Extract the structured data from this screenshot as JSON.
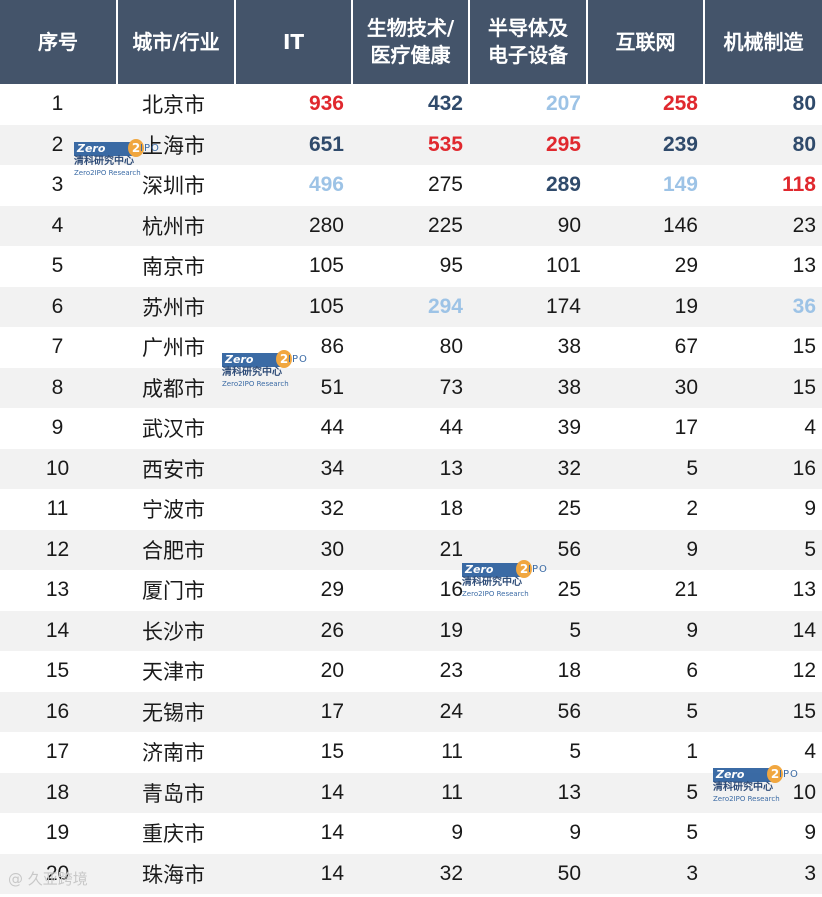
{
  "table": {
    "headers": [
      "序号",
      "城市/行业",
      "IT",
      "生物技术/\n医疗健康",
      "半导体及\n电子设备",
      "互联网",
      "机械制造"
    ],
    "rows": [
      {
        "rank": "1",
        "city": "北京市",
        "values": [
          "936",
          "432",
          "207",
          "258",
          "80"
        ]
      },
      {
        "rank": "2",
        "city": "上海市",
        "values": [
          "651",
          "535",
          "295",
          "239",
          "80"
        ]
      },
      {
        "rank": "3",
        "city": "深圳市",
        "values": [
          "496",
          "275",
          "289",
          "149",
          "118"
        ]
      },
      {
        "rank": "4",
        "city": "杭州市",
        "values": [
          "280",
          "225",
          "90",
          "146",
          "23"
        ]
      },
      {
        "rank": "5",
        "city": "南京市",
        "values": [
          "105",
          "95",
          "101",
          "29",
          "13"
        ]
      },
      {
        "rank": "6",
        "city": "苏州市",
        "values": [
          "105",
          "294",
          "174",
          "19",
          "36"
        ]
      },
      {
        "rank": "7",
        "city": "广州市",
        "values": [
          "86",
          "80",
          "38",
          "67",
          "15"
        ]
      },
      {
        "rank": "8",
        "city": "成都市",
        "values": [
          "51",
          "73",
          "38",
          "30",
          "15"
        ]
      },
      {
        "rank": "9",
        "city": "武汉市",
        "values": [
          "44",
          "44",
          "39",
          "17",
          "4"
        ]
      },
      {
        "rank": "10",
        "city": "西安市",
        "values": [
          "34",
          "13",
          "32",
          "5",
          "16"
        ]
      },
      {
        "rank": "11",
        "city": "宁波市",
        "values": [
          "32",
          "18",
          "25",
          "2",
          "9"
        ]
      },
      {
        "rank": "12",
        "city": "合肥市",
        "values": [
          "30",
          "21",
          "56",
          "9",
          "5"
        ]
      },
      {
        "rank": "13",
        "city": "厦门市",
        "values": [
          "29",
          "16",
          "25",
          "21",
          "13"
        ]
      },
      {
        "rank": "14",
        "city": "长沙市",
        "values": [
          "26",
          "19",
          "5",
          "9",
          "14"
        ]
      },
      {
        "rank": "15",
        "city": "天津市",
        "values": [
          "20",
          "23",
          "18",
          "6",
          "12"
        ]
      },
      {
        "rank": "16",
        "city": "无锡市",
        "values": [
          "17",
          "24",
          "56",
          "5",
          "15"
        ]
      },
      {
        "rank": "17",
        "city": "济南市",
        "values": [
          "15",
          "11",
          "5",
          "1",
          "4"
        ]
      },
      {
        "rank": "18",
        "city": "青岛市",
        "values": [
          "14",
          "11",
          "13",
          "5",
          "10"
        ]
      },
      {
        "rank": "19",
        "city": "重庆市",
        "values": [
          "14",
          "9",
          "9",
          "5",
          "9"
        ]
      },
      {
        "rank": "20",
        "city": "珠海市",
        "values": [
          "14",
          "32",
          "50",
          "3",
          "3"
        ]
      }
    ],
    "highlights": [
      {
        "row": 0,
        "col": 0,
        "tier": "red"
      },
      {
        "row": 0,
        "col": 1,
        "tier": "navy"
      },
      {
        "row": 0,
        "col": 2,
        "tier": "light"
      },
      {
        "row": 0,
        "col": 3,
        "tier": "red"
      },
      {
        "row": 0,
        "col": 4,
        "tier": "navy"
      },
      {
        "row": 1,
        "col": 0,
        "tier": "navy"
      },
      {
        "row": 1,
        "col": 1,
        "tier": "red"
      },
      {
        "row": 1,
        "col": 2,
        "tier": "red"
      },
      {
        "row": 1,
        "col": 3,
        "tier": "navy"
      },
      {
        "row": 1,
        "col": 4,
        "tier": "navy"
      },
      {
        "row": 2,
        "col": 0,
        "tier": "light"
      },
      {
        "row": 2,
        "col": 2,
        "tier": "navy"
      },
      {
        "row": 2,
        "col": 3,
        "tier": "light"
      },
      {
        "row": 2,
        "col": 4,
        "tier": "red"
      },
      {
        "row": 5,
        "col": 1,
        "tier": "light"
      },
      {
        "row": 5,
        "col": 4,
        "tier": "light"
      }
    ]
  },
  "colors": {
    "header_bg": "#44546a",
    "highlight_red": "#e0282e",
    "highlight_navy": "#2f4a6b",
    "highlight_light": "#9dc3e6",
    "stripe": "#f2f2f2"
  },
  "watermark": {
    "brand": "Zero",
    "digit": "2",
    "suffix": "IPO",
    "cn": "清科研究中心",
    "en": "Zero2IPO Research"
  },
  "source_watermark": "@ 久亚跨境"
}
